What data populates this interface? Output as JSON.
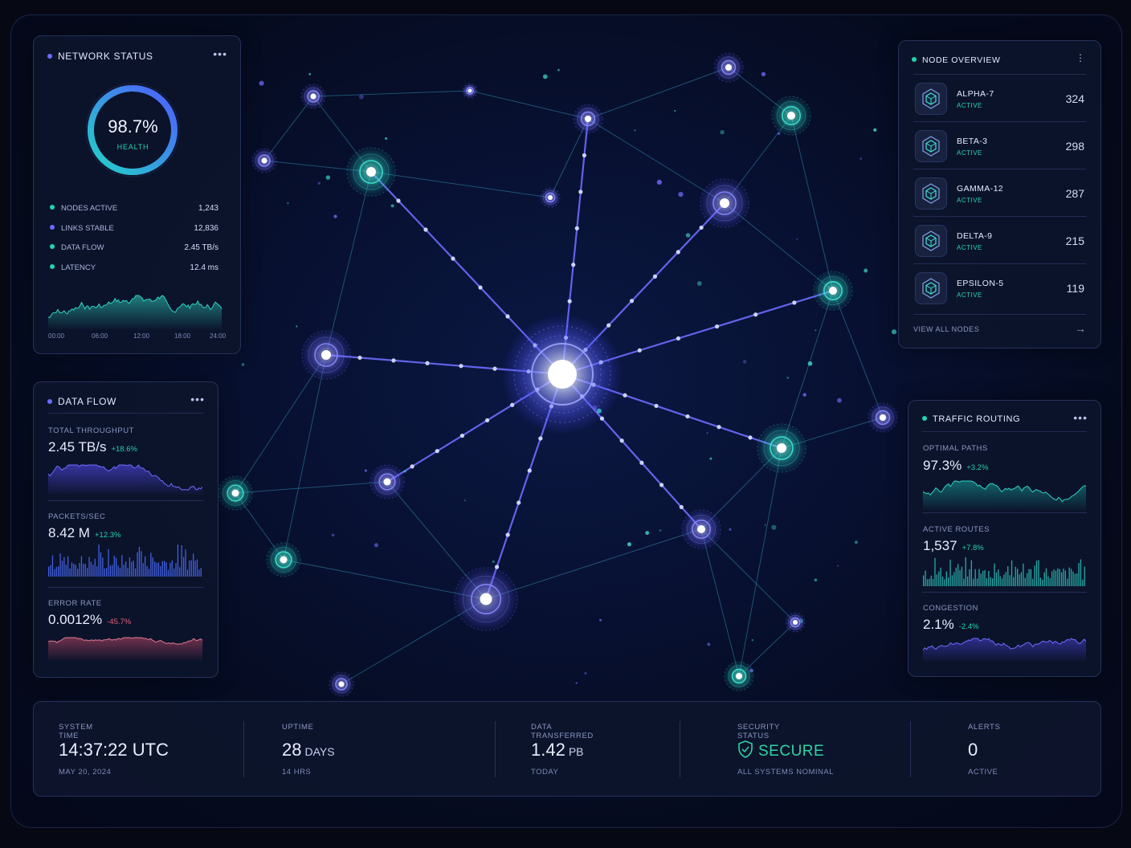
{
  "network_status": {
    "title": "NETWORK STATUS",
    "health_value": "98.7%",
    "health_label": "HEALTH",
    "health_fraction": 0.987,
    "stats": [
      {
        "label": "NODES ACTIVE",
        "value": "1,243",
        "color": "#22d3b0"
      },
      {
        "label": "LINKS STABLE",
        "value": "12,836",
        "color": "#6b6bff"
      },
      {
        "label": "DATA FLOW",
        "value": "2.45 TB/s",
        "color": "#22d3b0"
      },
      {
        "label": "LATENCY",
        "value": "12.4 ms",
        "color": "#22d3b0"
      }
    ],
    "time_ticks": [
      "00:00",
      "06:00",
      "12:00",
      "18:00",
      "24:00"
    ]
  },
  "data_flow": {
    "title": "DATA FLOW",
    "metrics": [
      {
        "label": "TOTAL THROUGHPUT",
        "value": "2.45 TB/s",
        "delta": "+18.6%",
        "delta_color": "#22d3b0"
      },
      {
        "label": "PACKETS/SEC",
        "value": "8.42 M",
        "delta": "+12.3%",
        "delta_color": "#22d3b0"
      },
      {
        "label": "ERROR RATE",
        "value": "0.0012%",
        "delta": "-45.7%",
        "delta_color": "#e0607a"
      }
    ]
  },
  "node_overview": {
    "title": "NODE OVERVIEW",
    "nodes": [
      {
        "name": "ALPHA-7",
        "status": "ACTIVE",
        "value": "324"
      },
      {
        "name": "BETA-3",
        "status": "ACTIVE",
        "value": "298"
      },
      {
        "name": "GAMMA-12",
        "status": "ACTIVE",
        "value": "287"
      },
      {
        "name": "DELTA-9",
        "status": "ACTIVE",
        "value": "215"
      },
      {
        "name": "EPSILON-5",
        "status": "ACTIVE",
        "value": "119"
      }
    ],
    "view_all": "VIEW ALL NODES"
  },
  "traffic_routing": {
    "title": "TRAFFIC ROUTING",
    "metrics": [
      {
        "label": "OPTIMAL PATHS",
        "value": "97.3%",
        "delta": "+3.2%",
        "delta_color": "#22d3b0"
      },
      {
        "label": "ACTIVE ROUTES",
        "value": "1,537",
        "delta": "+7.8%",
        "delta_color": "#22d3b0"
      },
      {
        "label": "CONGESTION",
        "value": "2.1%",
        "delta": "-2.4%",
        "delta_color": "#22d3b0"
      }
    ]
  },
  "footer": {
    "system_time": {
      "label": "SYSTEM TIME",
      "value": "14:37:22 UTC",
      "sub": "MAY 20, 2024"
    },
    "uptime": {
      "label": "UPTIME",
      "value": "28",
      "unit": "DAYS",
      "sub": "14 HRS"
    },
    "data_transferred": {
      "label": "DATA TRANSFERRED",
      "value": "1.42",
      "unit": "PB",
      "sub": "TODAY"
    },
    "security": {
      "label": "SECURITY STATUS",
      "value": "SECURE",
      "sub": "ALL SYSTEMS NOMINAL",
      "color": "#2fd3a8"
    },
    "alerts": {
      "label": "ALERTS",
      "value": "0",
      "sub": "ACTIVE"
    }
  },
  "colors": {
    "accent_teal": "#22d3b0",
    "accent_blue": "#6b6bff",
    "panel_bg": "#0d152c"
  },
  "icons": {
    "menu": "more-dots-icon",
    "node": "cube-hex-icon",
    "arrow": "arrow-right-icon",
    "shield": "shield-check-icon"
  }
}
